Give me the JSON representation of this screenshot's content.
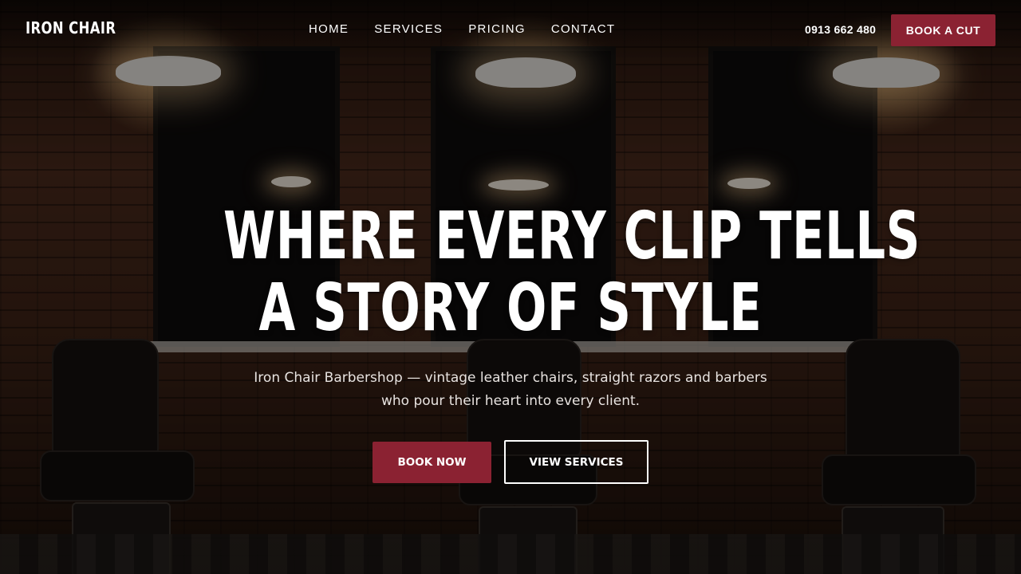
{
  "brand": {
    "name": "IRON CHAIR"
  },
  "nav": {
    "items": [
      {
        "label": "HOME"
      },
      {
        "label": "SERVICES"
      },
      {
        "label": "PRICING"
      },
      {
        "label": "CONTACT"
      }
    ]
  },
  "header": {
    "phone": "0913 662 480",
    "cta_label": "BOOK A CUT"
  },
  "hero": {
    "headline_line1": "WHERE EVERY CLIP TELLS",
    "headline_line2": "A STORY OF STYLE",
    "subtitle_line1": "Iron Chair Barbershop — vintage leather chairs, straight razors and barbers",
    "subtitle_line2": "who pour their heart into every client.",
    "primary_cta": "BOOK NOW",
    "secondary_cta": "VIEW SERVICES",
    "background_image": "barbershop-interior"
  },
  "colors": {
    "accent": "#8b2232",
    "text": "#ffffff"
  }
}
